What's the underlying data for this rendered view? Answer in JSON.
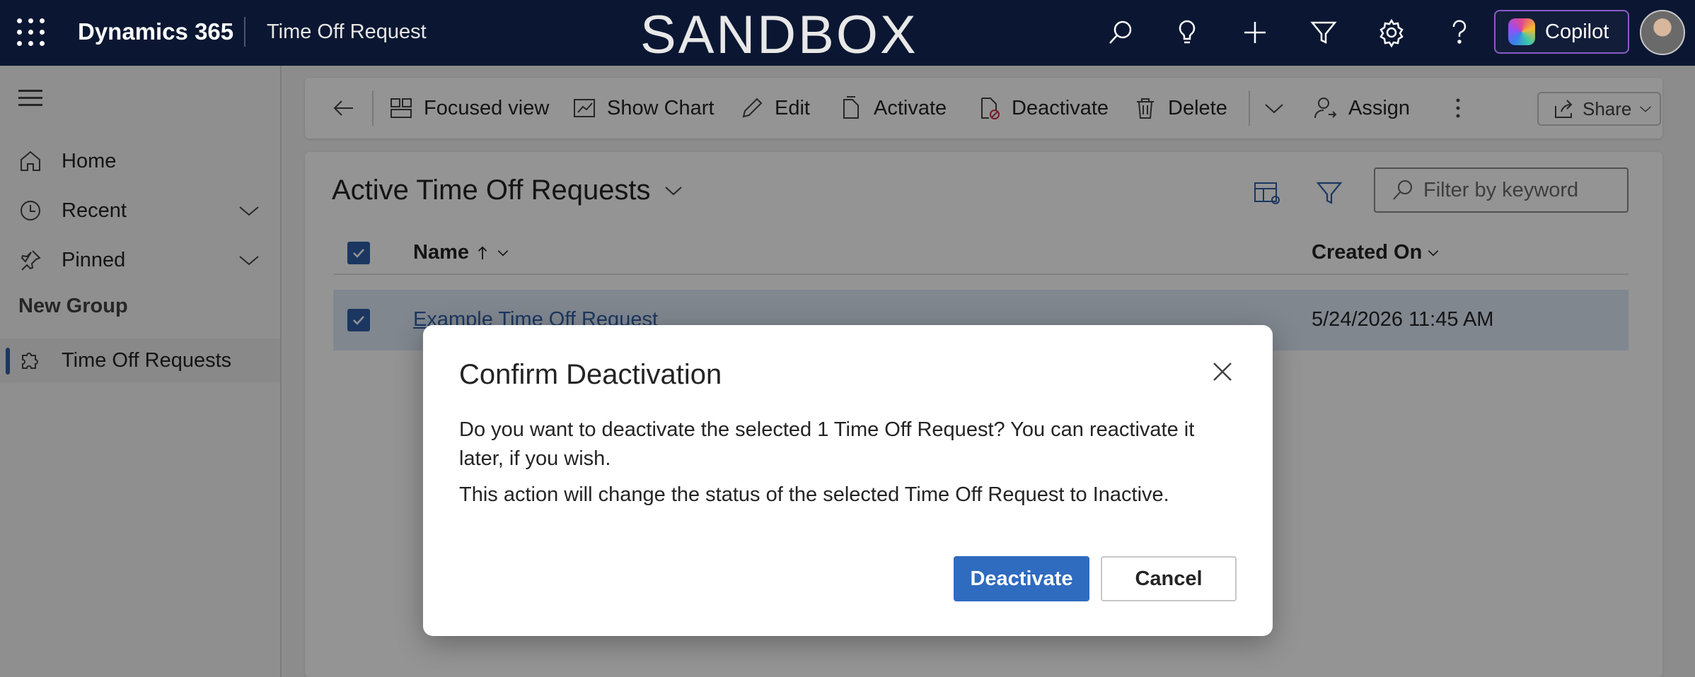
{
  "topbar": {
    "brand": "Dynamics 365",
    "app_title": "Time Off Request",
    "environment_label": "SANDBOX",
    "copilot_label": "Copilot",
    "icons": [
      "search-icon",
      "lightbulb-icon",
      "plus-icon",
      "filter-icon",
      "gear-icon",
      "help-icon"
    ]
  },
  "sidebar": {
    "items": [
      {
        "label": "Home",
        "icon": "home-icon"
      },
      {
        "label": "Recent",
        "icon": "clock-icon"
      },
      {
        "label": "Pinned",
        "icon": "pin-icon"
      }
    ],
    "group_label": "New Group",
    "group_items": [
      {
        "label": "Time Off Requests",
        "icon": "puzzle-icon",
        "active": true
      }
    ]
  },
  "commandbar": {
    "focused_view": "Focused view",
    "show_chart": "Show Chart",
    "edit": "Edit",
    "activate": "Activate",
    "deactivate": "Deactivate",
    "delete": "Delete",
    "assign": "Assign",
    "share": "Share"
  },
  "grid": {
    "view_title": "Active Time Off Requests",
    "filter_placeholder": "Filter by keyword",
    "columns": {
      "name": "Name",
      "created_on": "Created On"
    },
    "rows": [
      {
        "name": "Example Time Off Request",
        "created_on": "5/24/2026 11:45 AM",
        "selected": true
      }
    ]
  },
  "dialog": {
    "title": "Confirm Deactivation",
    "message": "Do you want to deactivate the selected 1 Time Off Request? You can reactivate it later, if you wish.",
    "detail": "This action will change the status of the selected Time Off Request to Inactive.",
    "confirm_label": "Deactivate",
    "cancel_label": "Cancel"
  },
  "colors": {
    "topbar_bg": "#0b1732",
    "accent": "#2f6bbf",
    "selection_bg": "#dfe9f6"
  }
}
